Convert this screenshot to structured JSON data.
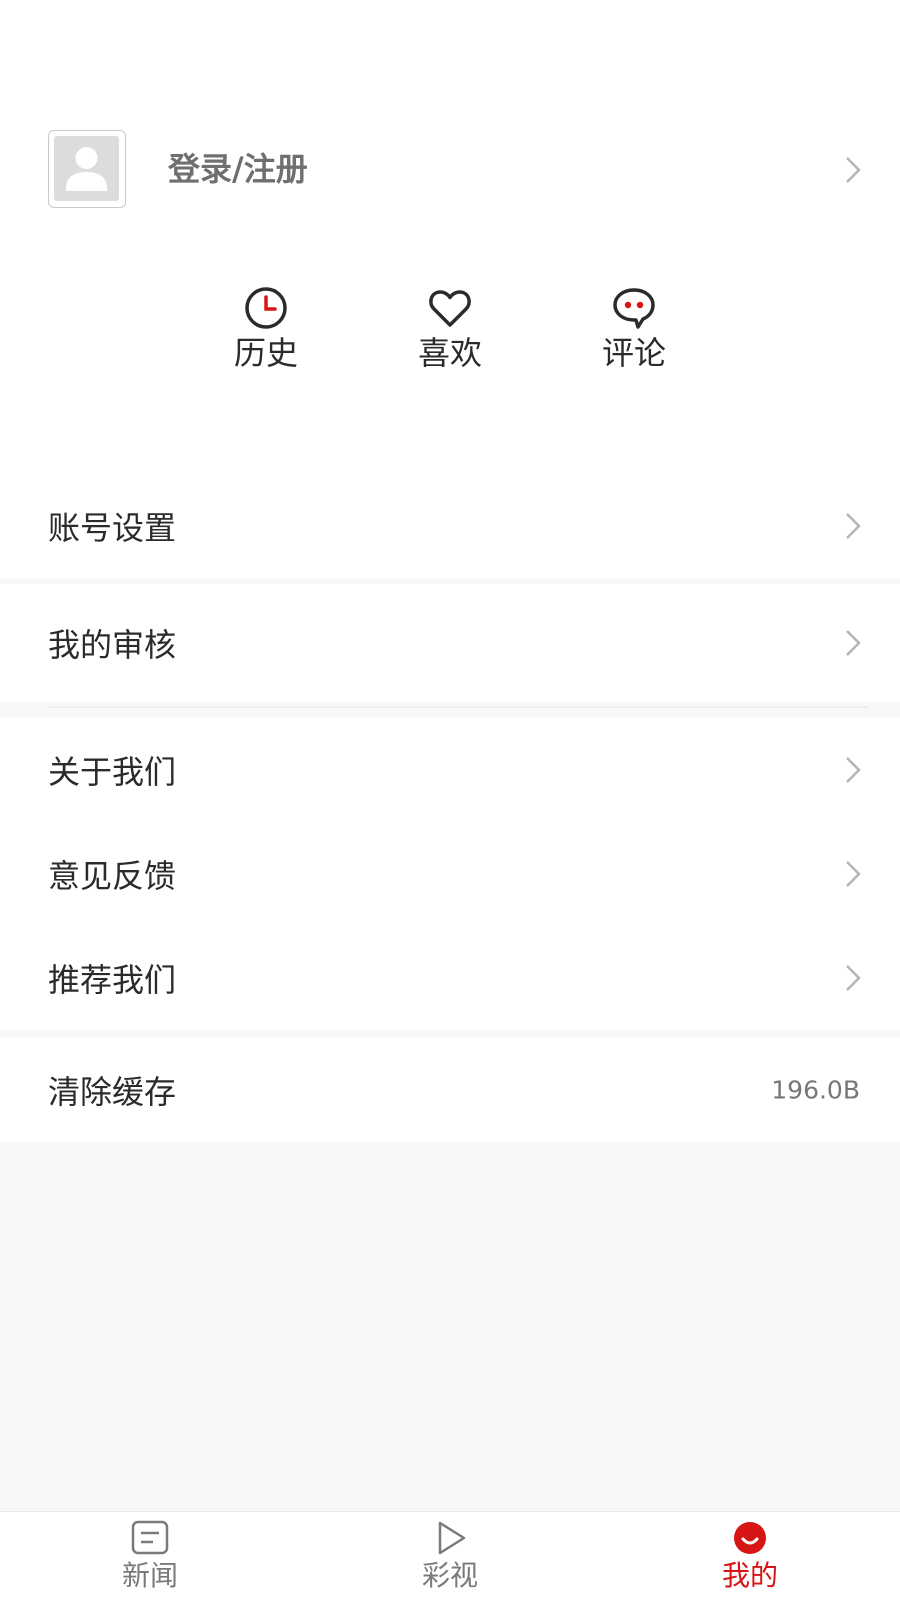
{
  "profile": {
    "login_label": "登录/注册"
  },
  "quick_actions": [
    {
      "label": "历史",
      "icon": "clock-icon"
    },
    {
      "label": "喜欢",
      "icon": "heart-icon"
    },
    {
      "label": "评论",
      "icon": "comment-icon"
    }
  ],
  "menu": {
    "account_settings": "账号设置",
    "my_review": "我的审核",
    "about_us": "关于我们",
    "feedback": "意见反馈",
    "recommend_us": "推荐我们",
    "clear_cache": "清除缓存",
    "cache_size": "196.0B"
  },
  "tabbar": [
    {
      "label": "新闻",
      "icon": "news-icon",
      "active": false
    },
    {
      "label": "彩视",
      "icon": "play-icon",
      "active": false
    },
    {
      "label": "我的",
      "icon": "smile-icon",
      "active": true
    }
  ],
  "colors": {
    "accent": "#d71515",
    "background": "#f8f8f8",
    "text": "#2b2b2b"
  }
}
